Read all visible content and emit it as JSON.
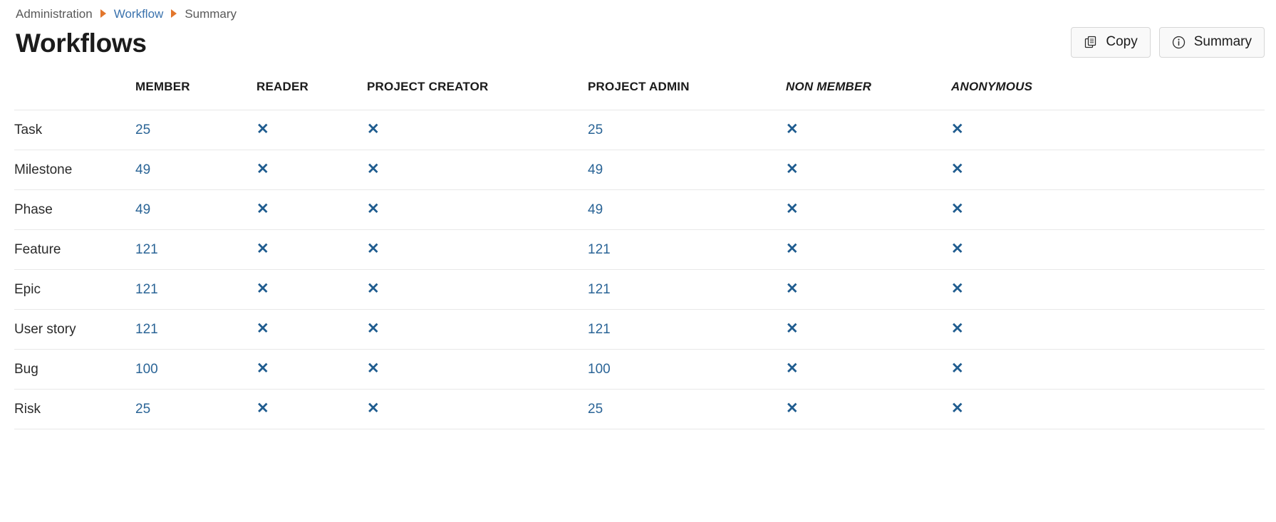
{
  "breadcrumb": {
    "items": [
      {
        "label": "Administration",
        "type": "muted"
      },
      {
        "label": "Workflow",
        "type": "link"
      },
      {
        "label": "Summary",
        "type": "muted"
      }
    ]
  },
  "header": {
    "title": "Workflows",
    "actions": [
      {
        "label": "Copy",
        "icon": "copy-icon"
      },
      {
        "label": "Summary",
        "icon": "info-circle-icon"
      }
    ]
  },
  "table": {
    "row_header_label": "",
    "columns": [
      {
        "label": "MEMBER",
        "builtin": false
      },
      {
        "label": "READER",
        "builtin": false
      },
      {
        "label": "PROJECT CREATOR",
        "builtin": false
      },
      {
        "label": "PROJECT ADMIN",
        "builtin": false
      },
      {
        "label": "NON MEMBER",
        "builtin": true
      },
      {
        "label": "ANONYMOUS",
        "builtin": true
      }
    ],
    "cross_glyph": "✕",
    "rows": [
      {
        "name": "Task",
        "cells": [
          "25",
          "x",
          "x",
          "25",
          "x",
          "x"
        ]
      },
      {
        "name": "Milestone",
        "cells": [
          "49",
          "x",
          "x",
          "49",
          "x",
          "x"
        ]
      },
      {
        "name": "Phase",
        "cells": [
          "49",
          "x",
          "x",
          "49",
          "x",
          "x"
        ]
      },
      {
        "name": "Feature",
        "cells": [
          "121",
          "x",
          "x",
          "121",
          "x",
          "x"
        ]
      },
      {
        "name": "Epic",
        "cells": [
          "121",
          "x",
          "x",
          "121",
          "x",
          "x"
        ]
      },
      {
        "name": "User story",
        "cells": [
          "121",
          "x",
          "x",
          "121",
          "x",
          "x"
        ]
      },
      {
        "name": "Bug",
        "cells": [
          "100",
          "x",
          "x",
          "100",
          "x",
          "x"
        ]
      },
      {
        "name": "Risk",
        "cells": [
          "25",
          "x",
          "x",
          "25",
          "x",
          "x"
        ]
      }
    ]
  },
  "colors": {
    "link": "#2a6496",
    "breadcrumb_link": "#3a72ad",
    "breadcrumb_sep": "#e2762c",
    "cross": "#1f5c8f",
    "border": "#e8e8e8",
    "button_bg": "#f9f9f9"
  }
}
